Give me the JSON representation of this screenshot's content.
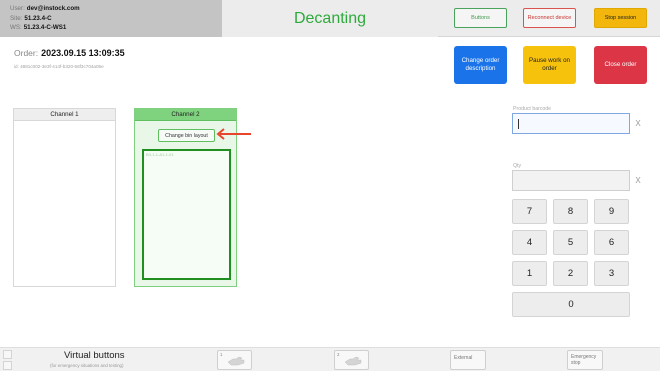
{
  "header": {
    "user_label": "User:",
    "user_value": "dev@instock.com",
    "site_label": "Site:",
    "site_value": "51.23.4-C",
    "ws_label": "WS:",
    "ws_value": "51.23.4-C-WS1",
    "title": "Decanting",
    "buttons_label": "Buttons",
    "reconnect_label": "Reconnect device",
    "stop_label": "Stop session"
  },
  "order": {
    "label": "Order:",
    "datetime": "2023.09.15 13:09:35",
    "id": "id: 4881c002-3e3f-414f-b320-58f3c704a05e"
  },
  "actions": {
    "change_label": "Change order description",
    "pause_label": "Pause work on order",
    "close_label": "Close order"
  },
  "channels": {
    "channel1_title": "Channel 1",
    "channel2_title": "Channel 2",
    "bin_button_label": "Change bin layout",
    "bin_label": "B3-1-1-A1-1-01"
  },
  "inputs": {
    "barcode_label": "Product barcode",
    "barcode_value": "",
    "qty_label": "Qty",
    "qty_value": "",
    "clear_symbol": "X"
  },
  "keypad": {
    "keys": [
      "7",
      "8",
      "9",
      "4",
      "5",
      "6",
      "1",
      "2",
      "3"
    ],
    "zero": "0"
  },
  "footer": {
    "title": "Virtual buttons",
    "subtitle": "(for emergency situations and testing)",
    "vb1_num": "1",
    "vb2_num": "2",
    "external_label": "External",
    "emergency_label": "Emergency stop"
  },
  "colors": {
    "title_green": "#2eaa3c",
    "primary_blue": "#1a73e8",
    "warning_yellow": "#f7c20c",
    "danger_red": "#dc3545",
    "channel_active_green": "#7fd37f",
    "arrow_red": "#e8452c"
  },
  "icons": {
    "arrow": "left-arrow-icon",
    "virtual_button": "hand-pointer-icon"
  }
}
